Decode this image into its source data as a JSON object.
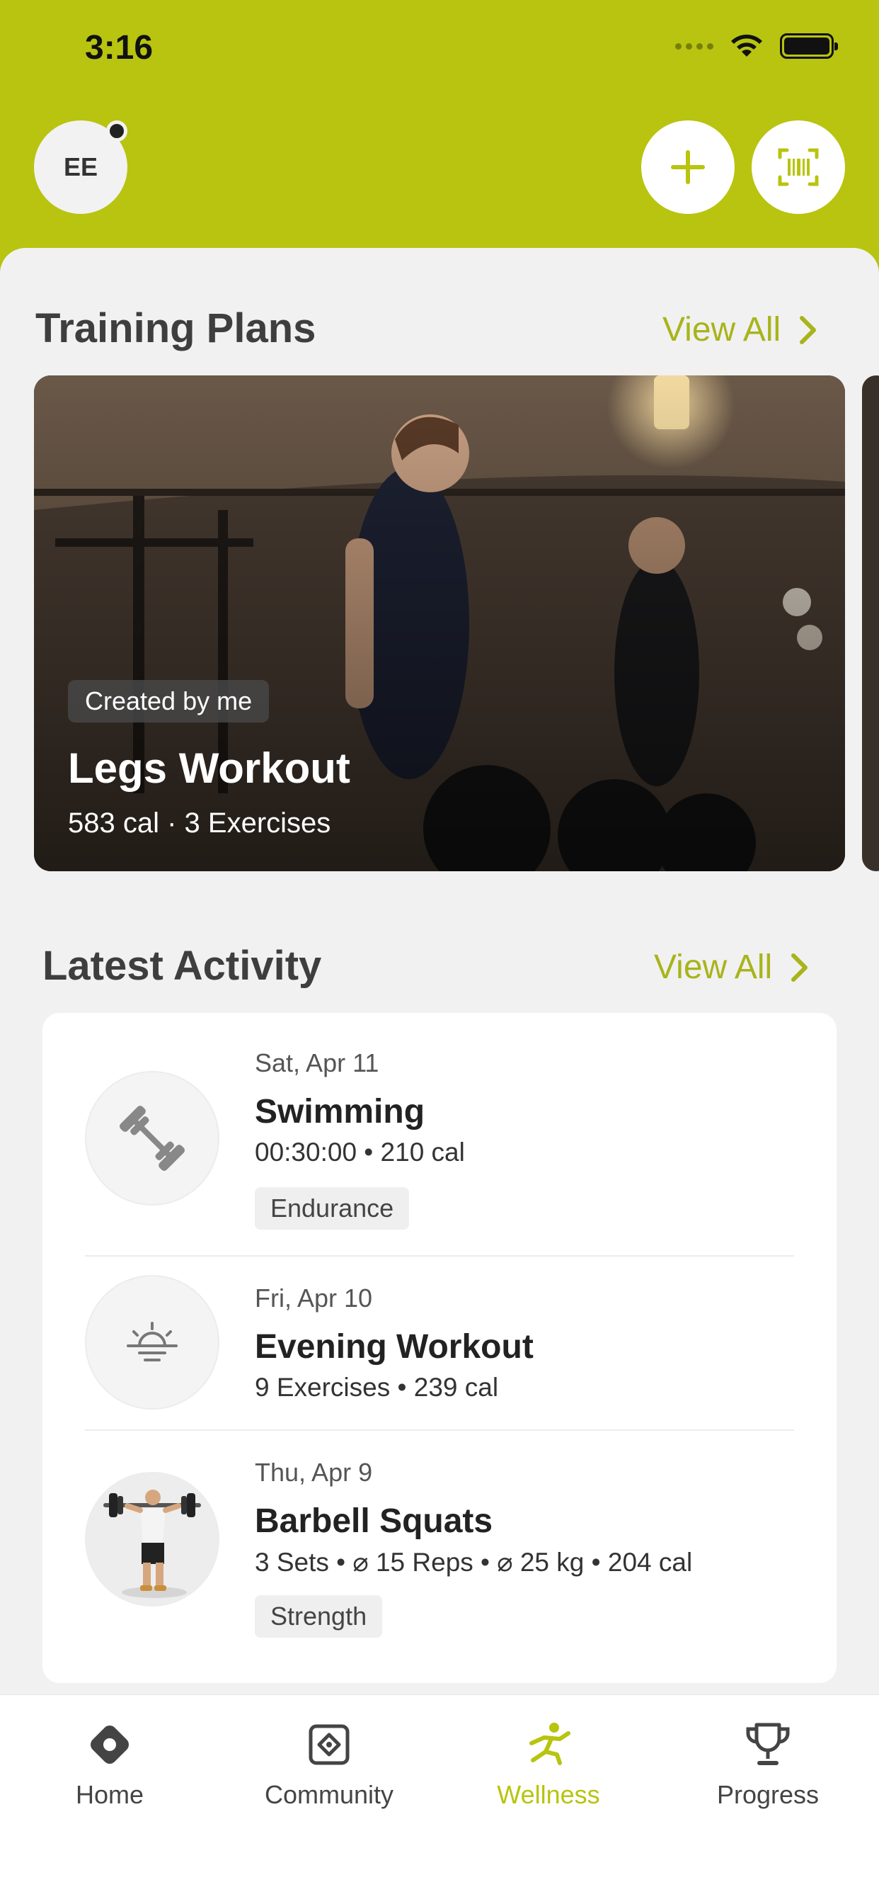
{
  "status": {
    "time": "3:16"
  },
  "header": {
    "avatar_initials": "EE",
    "add_icon": "plus-icon",
    "scan_icon": "barcode-scan-icon"
  },
  "training_plans": {
    "title": "Training Plans",
    "view_all": "View All",
    "cards": [
      {
        "badge": "Created by me",
        "title": "Legs Workout",
        "meta": "583 cal · 3 Exercises"
      }
    ]
  },
  "latest_activity": {
    "title": "Latest Activity",
    "view_all": "View All",
    "items": [
      {
        "date": "Sat, Apr 11",
        "name": "Swimming",
        "meta": "00:30:00 • 210 cal",
        "tag": "Endurance",
        "icon": "dumbbell-icon"
      },
      {
        "date": "Fri, Apr 10",
        "name": "Evening Workout",
        "meta": "9 Exercises • 239 cal",
        "tag": "",
        "icon": "sunset-icon"
      },
      {
        "date": "Thu, Apr 9",
        "name": "Barbell Squats",
        "meta": "3 Sets • ⌀ 15 Reps • ⌀ 25 kg • 204 cal",
        "tag": "Strength",
        "icon": "barbell-athlete-image"
      }
    ]
  },
  "tabbar": {
    "tabs": [
      {
        "label": "Home",
        "icon": "home-diamond-icon"
      },
      {
        "label": "Community",
        "icon": "community-icon"
      },
      {
        "label": "Wellness",
        "icon": "wellness-runner-icon",
        "active": true
      },
      {
        "label": "Progress",
        "icon": "trophy-icon"
      }
    ]
  },
  "colors": {
    "accent": "#b8c40f",
    "background": "#f1f1f1"
  }
}
